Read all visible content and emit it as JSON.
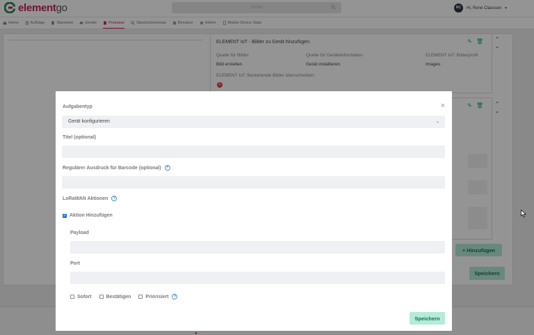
{
  "app": {
    "logo_part1": "element",
    "logo_part2": "go",
    "search_placeholder": "Suche",
    "user_initials": "RC",
    "user_greeting": "Hi, René Claussen"
  },
  "nav": {
    "items": [
      {
        "label": "Home",
        "icon": "home-icon",
        "active": false
      },
      {
        "label": "Aufträge",
        "icon": "list-icon",
        "active": false
      },
      {
        "label": "Standorte",
        "icon": "building-icon",
        "active": false
      },
      {
        "label": "Geräte",
        "icon": "car-icon",
        "active": false
      },
      {
        "label": "Prozesse",
        "icon": "clipboard-icon",
        "active": true
      },
      {
        "label": "Standortschemas",
        "icon": "search-icon",
        "active": false
      },
      {
        "label": "Benutzer",
        "icon": "users-icon",
        "active": false
      },
      {
        "label": "Admin",
        "icon": "gear-icon",
        "active": false
      },
      {
        "label": "Mobile Device Stats",
        "icon": "mobile-icon",
        "active": false
      }
    ],
    "accent_color": "#c81d5a"
  },
  "background": {
    "card1": {
      "title": "ELEMENT IoT - Bilder zu Gerät hinzufügen",
      "col1_header": "Quelle für Bilder",
      "col1_value": "Bild erstellen",
      "col2_header": "Quelle für Geräteinformation",
      "col2_value": "Gerät installieren",
      "col3_header": "ELEMENT IoT: Bilderprofil",
      "col3_value": "Images",
      "overwrite_label": "ELEMENT IoT: Bestehende Bilder überschreiben",
      "overwrite_value_icon": "x-circle-icon"
    },
    "add_button": "+ Hinzufügen",
    "save_button": "Speichern"
  },
  "modal": {
    "task_type_label": "Aufgabentyp",
    "task_type_value": "Gerät konfigurieren",
    "title_label": "Titel (optional)",
    "title_value": "",
    "regex_label": "Regulärer Ausdruck für Barcode (optional)",
    "regex_value": "",
    "lorawan_label": "LoRaWAN Aktionen",
    "add_action_label": "Aktion Hinzufügen",
    "add_action_checked": true,
    "payload_label": "Payload",
    "payload_value": "",
    "port_label": "Port",
    "port_value": "",
    "option_sofort": "Sofort",
    "option_bestaetigen": "Bestätigen",
    "option_priorisiert": "Priorisiert",
    "save_button": "Speichern",
    "close_symbol": "×"
  },
  "colors": {
    "button_bg": "#b4ebd9",
    "button_text": "#1c6d55",
    "help_icon": "#4a90c6",
    "checkbox": "#1a73e8"
  }
}
